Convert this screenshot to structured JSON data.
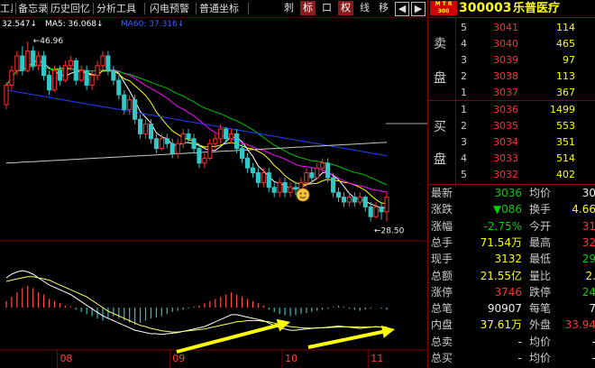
{
  "toolbar": {
    "items": [
      "工具",
      "备忘录",
      "历史回忆",
      "分析工具",
      "闪电预警",
      "普通坐标"
    ],
    "icons": [
      {
        "name": "bar-chart-icon",
        "glyph": "刺",
        "active": false
      },
      {
        "name": "candle-icon",
        "glyph": "标",
        "active": true
      },
      {
        "name": "grid-icon",
        "glyph": "口",
        "active": false
      },
      {
        "name": "rights-icon",
        "glyph": "权",
        "active": true
      },
      {
        "name": "line-icon",
        "glyph": "线",
        "active": false
      },
      {
        "name": "move-icon",
        "glyph": "移",
        "active": false
      },
      {
        "name": "prev-icon",
        "glyph": "◀",
        "active": false
      },
      {
        "name": "next-icon",
        "glyph": "▶",
        "active": false
      }
    ]
  },
  "chart_data": {
    "type": "candlestick",
    "ma_legend": [
      {
        "label": "32.547↓",
        "color": "#ffffff"
      },
      {
        "label": "MA5: 36.068↓",
        "color": "#ffffff"
      },
      {
        "label": "MA60: 37.316↓",
        "color": "#4060ff"
      }
    ],
    "high_label": "46.96",
    "low_label": "28.50",
    "ylim": [
      28,
      48
    ],
    "months": [
      "08",
      "09",
      "10",
      "11"
    ],
    "candles": [
      [
        40.5,
        42.5,
        40.0,
        42.8
      ],
      [
        42.5,
        44.0,
        42.0,
        44.5
      ],
      [
        44.0,
        45.5,
        43.5,
        46.0
      ],
      [
        45.5,
        44.0,
        43.5,
        46.5
      ],
      [
        44.0,
        46.0,
        43.8,
        46.96
      ],
      [
        46.0,
        44.5,
        44.0,
        46.5
      ],
      [
        44.5,
        45.5,
        44.0,
        46.0
      ],
      [
        45.5,
        43.5,
        43.0,
        46.0
      ],
      [
        43.5,
        42.0,
        41.5,
        44.0
      ],
      [
        42.0,
        44.0,
        41.8,
        44.5
      ],
      [
        44.0,
        43.0,
        42.5,
        44.5
      ],
      [
        43.0,
        44.5,
        42.8,
        45.0
      ],
      [
        44.5,
        45.0,
        44.0,
        45.5
      ],
      [
        45.0,
        43.0,
        42.5,
        45.3
      ],
      [
        43.0,
        44.0,
        42.8,
        44.5
      ],
      [
        44.0,
        42.5,
        42.0,
        44.5
      ],
      [
        42.5,
        43.5,
        42.0,
        44.0
      ],
      [
        43.5,
        44.5,
        43.0,
        45.0
      ],
      [
        44.5,
        45.5,
        44.0,
        46.0
      ],
      [
        45.5,
        44.0,
        43.5,
        46.0
      ],
      [
        44.0,
        43.0,
        42.5,
        44.5
      ],
      [
        43.0,
        41.5,
        41.0,
        43.5
      ],
      [
        41.5,
        40.0,
        39.5,
        42.0
      ],
      [
        40.0,
        41.0,
        39.5,
        41.5
      ],
      [
        41.0,
        39.0,
        38.5,
        41.5
      ],
      [
        39.0,
        37.5,
        37.0,
        39.5
      ],
      [
        37.5,
        38.5,
        37.0,
        39.0
      ],
      [
        38.5,
        37.0,
        36.5,
        39.0
      ],
      [
        37.0,
        36.0,
        35.5,
        37.5
      ],
      [
        36.0,
        37.0,
        35.8,
        37.5
      ],
      [
        37.0,
        36.5,
        36.0,
        37.5
      ],
      [
        36.5,
        35.5,
        35.0,
        37.0
      ],
      [
        35.5,
        36.5,
        35.0,
        37.0
      ],
      [
        36.5,
        37.5,
        36.0,
        38.0
      ],
      [
        37.5,
        37.0,
        36.5,
        38.0
      ],
      [
        37.0,
        36.0,
        35.5,
        37.5
      ],
      [
        36.0,
        34.5,
        34.0,
        36.5
      ],
      [
        34.5,
        35.0,
        34.0,
        35.5
      ],
      [
        35.0,
        36.5,
        34.8,
        37.0
      ],
      [
        36.5,
        37.0,
        36.0,
        37.5
      ],
      [
        37.0,
        38.0,
        36.5,
        38.5
      ],
      [
        38.0,
        37.0,
        36.5,
        38.2
      ],
      [
        37.0,
        37.5,
        36.5,
        38.0
      ],
      [
        37.5,
        36.0,
        35.5,
        38.0
      ],
      [
        36.0,
        35.0,
        34.5,
        36.5
      ],
      [
        35.0,
        34.0,
        33.5,
        35.5
      ],
      [
        34.0,
        33.5,
        33.0,
        34.5
      ],
      [
        33.5,
        32.5,
        32.0,
        34.0
      ],
      [
        32.5,
        33.5,
        32.0,
        34.0
      ],
      [
        33.5,
        32.0,
        31.5,
        34.0
      ],
      [
        32.0,
        31.5,
        31.0,
        32.5
      ],
      [
        31.5,
        32.5,
        31.0,
        33.0
      ],
      [
        32.5,
        31.5,
        31.0,
        33.0
      ],
      [
        31.5,
        32.0,
        31.0,
        32.5
      ],
      [
        32.0,
        31.8,
        31.2,
        32.5
      ],
      [
        31.8,
        32.5,
        31.5,
        33.0
      ],
      [
        32.5,
        33.5,
        32.0,
        34.0
      ],
      [
        33.5,
        33.0,
        32.5,
        34.0
      ],
      [
        33.0,
        34.0,
        32.8,
        34.5
      ],
      [
        34.0,
        34.5,
        33.5,
        35.0
      ],
      [
        34.5,
        33.0,
        32.5,
        35.0
      ],
      [
        33.0,
        31.5,
        31.0,
        33.5
      ],
      [
        31.5,
        31.0,
        30.5,
        32.0
      ],
      [
        31.0,
        30.5,
        30.0,
        31.5
      ],
      [
        30.5,
        31.0,
        30.0,
        31.5
      ],
      [
        31.0,
        30.5,
        30.0,
        31.5
      ],
      [
        30.5,
        31.0,
        30.2,
        31.5
      ],
      [
        31.0,
        30.0,
        29.5,
        31.2
      ],
      [
        30.0,
        29.0,
        28.5,
        30.5
      ],
      [
        29.0,
        30.0,
        28.8,
        30.5
      ],
      [
        30.0,
        29.5,
        28.7,
        30.5
      ],
      [
        29.5,
        31.0,
        28.5,
        31.5
      ]
    ],
    "macd": {
      "hist": [
        0.3,
        0.5,
        0.7,
        0.9,
        1.0,
        0.9,
        0.7,
        0.6,
        0.4,
        0.3,
        0.2,
        0.1,
        0.05,
        -0.1,
        -0.2,
        -0.3,
        -0.4,
        -0.5,
        -0.6,
        -0.5,
        -0.4,
        -0.5,
        -0.6,
        -0.7,
        -0.8,
        -0.7,
        -0.6,
        -0.5,
        -0.45,
        -0.4,
        -0.3,
        -0.2,
        -0.15,
        -0.1,
        -0.05,
        0.05,
        0.1,
        0.2,
        0.3,
        0.4,
        0.5,
        0.6,
        0.7,
        0.6,
        0.5,
        0.4,
        0.3,
        0.2,
        0.1,
        -0.1,
        -0.2,
        -0.3,
        -0.35,
        -0.4,
        -0.35,
        -0.3,
        -0.25,
        -0.2,
        -0.15,
        -0.1,
        -0.05,
        0.05,
        0.1,
        0.05,
        -0.05,
        -0.1,
        -0.15,
        -0.1,
        -0.05,
        0.0,
        -0.05,
        -0.1
      ],
      "dif": [
        2.5,
        2.8,
        3.0,
        3.1,
        3.0,
        2.8,
        2.5,
        2.2,
        1.9,
        1.7,
        1.5,
        1.3,
        1.1,
        0.8,
        0.5,
        0.2,
        -0.1,
        -0.4,
        -0.7,
        -0.9,
        -1.1,
        -1.3,
        -1.5,
        -1.7,
        -1.9,
        -2.0,
        -2.1,
        -2.2,
        -2.2,
        -2.25,
        -2.2,
        -2.15,
        -2.1,
        -2.0,
        -1.9,
        -1.8,
        -1.7,
        -1.6,
        -1.4,
        -1.2,
        -1.0,
        -0.8,
        -0.6,
        -0.6,
        -0.7,
        -0.8,
        -0.9,
        -1.0,
        -1.1,
        -1.3,
        -1.5,
        -1.7,
        -1.8,
        -1.9,
        -1.9,
        -1.85,
        -1.8,
        -1.75,
        -1.7,
        -1.7,
        -1.65,
        -1.6,
        -1.55,
        -1.6,
        -1.65,
        -1.7,
        -1.75,
        -1.7,
        -1.65,
        -1.6,
        -1.65,
        -1.7
      ],
      "dea": [
        2.2,
        2.3,
        2.4,
        2.5,
        2.6,
        2.6,
        2.5,
        2.4,
        2.3,
        2.1,
        1.9,
        1.7,
        1.5,
        1.3,
        1.1,
        0.9,
        0.6,
        0.3,
        0.0,
        -0.3,
        -0.5,
        -0.7,
        -0.9,
        -1.1,
        -1.3,
        -1.5,
        -1.6,
        -1.75,
        -1.85,
        -1.95,
        -2.0,
        -2.05,
        -2.05,
        -2.0,
        -1.95,
        -1.9,
        -1.85,
        -1.8,
        -1.7,
        -1.6,
        -1.5,
        -1.4,
        -1.3,
        -1.2,
        -1.15,
        -1.1,
        -1.1,
        -1.1,
        -1.15,
        -1.2,
        -1.3,
        -1.4,
        -1.5,
        -1.6,
        -1.65,
        -1.7,
        -1.72,
        -1.72,
        -1.72,
        -1.7,
        -1.68,
        -1.66,
        -1.64,
        -1.62,
        -1.62,
        -1.62,
        -1.64,
        -1.64,
        -1.63,
        -1.62,
        -1.62,
        -1.63
      ]
    },
    "colors": {
      "up": "#ff3232",
      "down": "#32c8c8",
      "ma5": "#ffffff",
      "ma10": "#ffff00",
      "ma20": "#ff00ff",
      "ma30": "#00c000",
      "ma60": "#2040ff",
      "ma120": "#c8c8c8",
      "arrow": "#ffff00"
    }
  },
  "stock": {
    "badge": "M T R 300",
    "code": "300003",
    "name": "乐普医疗"
  },
  "orderbook": {
    "sell_label": [
      "卖",
      "盘"
    ],
    "buy_label": [
      "买",
      "盘"
    ],
    "sells": [
      {
        "n": "5",
        "price": "3041",
        "vol": "114"
      },
      {
        "n": "4",
        "price": "3040",
        "vol": "465"
      },
      {
        "n": "3",
        "price": "3039",
        "vol": "97"
      },
      {
        "n": "2",
        "price": "3038",
        "vol": "113"
      },
      {
        "n": "1",
        "price": "3037",
        "vol": "367"
      }
    ],
    "buys": [
      {
        "n": "1",
        "price": "3036",
        "vol": "1499"
      },
      {
        "n": "2",
        "price": "3035",
        "vol": "553"
      },
      {
        "n": "3",
        "price": "3034",
        "vol": "351"
      },
      {
        "n": "4",
        "price": "3033",
        "vol": "514"
      },
      {
        "n": "5",
        "price": "3032",
        "vol": "402"
      }
    ]
  },
  "info": [
    {
      "l1": "最新",
      "v1": "3036",
      "c1": "green",
      "l2": "均价",
      "v2": "30",
      "c2": "white"
    },
    {
      "l1": "涨跌",
      "v1": "▼086",
      "c1": "green",
      "l2": "换手",
      "v2": "4.66",
      "c2": "yellow"
    },
    {
      "l1": "涨幅",
      "v1": "-2.75%",
      "c1": "green",
      "l2": "今开",
      "v2": "31",
      "c2": "red"
    },
    {
      "l1": "总手",
      "v1": "71.54万",
      "c1": "yellow",
      "l2": "最高",
      "v2": "32",
      "c2": "red"
    },
    {
      "l1": "现手",
      "v1": "3132",
      "c1": "yellow",
      "l2": "最低",
      "v2": "29",
      "c2": "green"
    },
    {
      "l1": "总额",
      "v1": "21.55亿",
      "c1": "yellow",
      "l2": "量比",
      "v2": "2.",
      "c2": "yellow"
    },
    {
      "l1": "涨停",
      "v1": "3746",
      "c1": "red",
      "l2": "跌停",
      "v2": "24",
      "c2": "green"
    },
    {
      "l1": "总笔",
      "v1": "90907",
      "c1": "white",
      "l2": "每笔",
      "v2": "7",
      "c2": "white"
    },
    {
      "l1": "内盘",
      "v1": "37.61万",
      "c1": "yellow",
      "l2": "外盘",
      "v2": "33.94",
      "c2": "red"
    },
    {
      "l1": "总卖",
      "v1": "-",
      "c1": "white",
      "l2": "均价",
      "v2": "-",
      "c2": "white"
    },
    {
      "l1": "总买",
      "v1": "-",
      "c1": "white",
      "l2": "均价",
      "v2": "-",
      "c2": "white"
    }
  ]
}
